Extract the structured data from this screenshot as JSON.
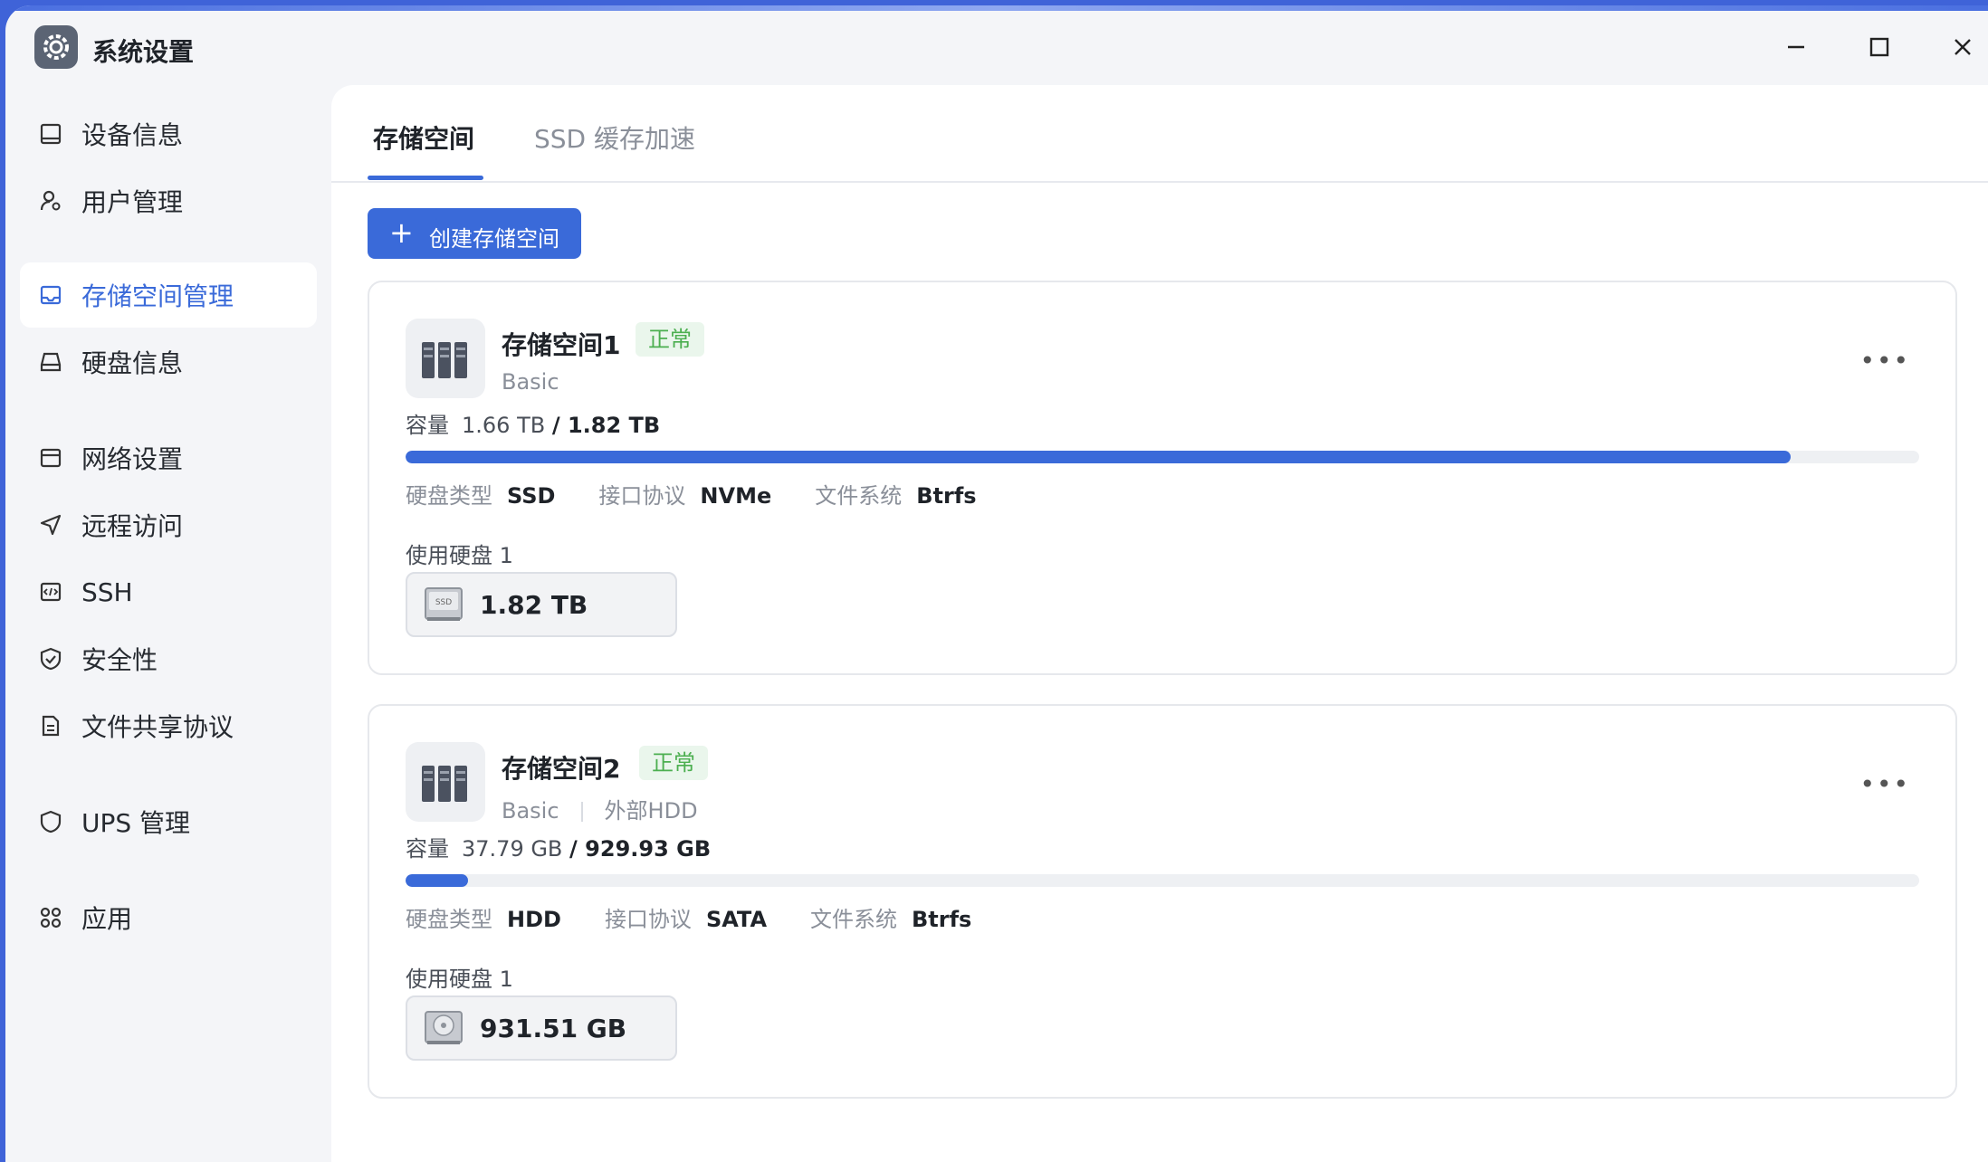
{
  "app": {
    "title": "系统设置"
  },
  "window_controls": {
    "minimize": "minimize-icon",
    "maximize": "maximize-icon",
    "close": "close-icon"
  },
  "sidebar": {
    "items": [
      {
        "label": "设备信息",
        "icon": "device-icon"
      },
      {
        "label": "用户管理",
        "icon": "user-gear-icon"
      },
      {
        "label": "存储空间管理",
        "icon": "storage-icon",
        "active": true
      },
      {
        "label": "硬盘信息",
        "icon": "drive-icon"
      },
      {
        "label": "网络设置",
        "icon": "network-icon"
      },
      {
        "label": "远程访问",
        "icon": "send-icon"
      },
      {
        "label": "SSH",
        "icon": "code-icon"
      },
      {
        "label": "安全性",
        "icon": "shield-check-icon"
      },
      {
        "label": "文件共享协议",
        "icon": "document-icon"
      },
      {
        "label": "UPS 管理",
        "icon": "shield-icon"
      },
      {
        "label": "应用",
        "icon": "apps-icon"
      }
    ]
  },
  "tabs": [
    {
      "label": "存储空间"
    },
    {
      "label": "SSD 缓存加速"
    }
  ],
  "create_button": {
    "label": "创建存储空间"
  },
  "labels": {
    "capacity": "容量",
    "disk_type": "硬盘类型",
    "interface": "接口协议",
    "filesystem": "文件系统",
    "disks_used": "使用硬盘 1"
  },
  "pools": [
    {
      "name": "存储空间1",
      "status": "正常",
      "raid": "Basic",
      "extra": "",
      "used": "1.66 TB",
      "total": "/ 1.82 TB",
      "usage_fraction": 0.915,
      "disk_type": "SSD",
      "interface": "NVMe",
      "filesystem": "Btrfs",
      "disk_size": "1.82 TB",
      "disk_kind": "ssd"
    },
    {
      "name": "存储空间2",
      "status": "正常",
      "raid": "Basic",
      "extra": "外部HDD",
      "used": "37.79 GB",
      "total": "/ 929.93 GB",
      "usage_fraction": 0.041,
      "disk_type": "HDD",
      "interface": "SATA",
      "filesystem": "Btrfs",
      "disk_size": "931.51 GB",
      "disk_kind": "hdd"
    }
  ],
  "colors": {
    "accent": "#3a6ad9",
    "status_ok_bg": "#eaf6ec",
    "status_ok_text": "#4caf50"
  }
}
